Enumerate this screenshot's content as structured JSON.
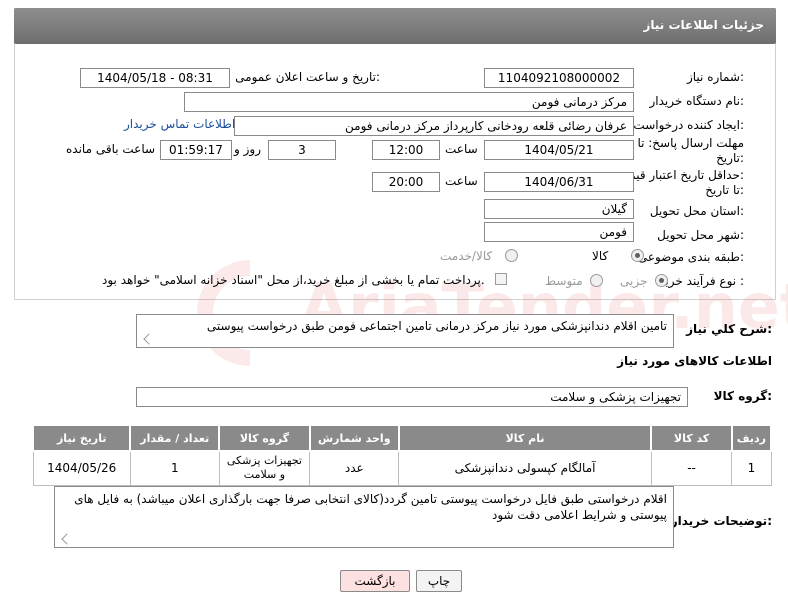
{
  "header": {
    "title": "جزئیات اطلاعات نیاز"
  },
  "form": {
    "need_number_label": "شماره نیاز:",
    "need_number": "1104092108000002",
    "announce_label": "تاریخ و ساعت اعلان عمومی:",
    "announce_value": "1404/05/18 - 08:31",
    "buyer_org_label": "نام دستگاه خریدار:",
    "buyer_org": "مرکز درمانی فومن",
    "requester_label": "ایجاد کننده درخواست:",
    "requester": "عرفان رضائی قلعه رودخانی کارپرداز مرکز درمانی فومن",
    "buyer_contact_link": "اطلاعات تماس خریدار",
    "deadline_label_1": "مهلت ارسال پاسخ: تا",
    "deadline_label_2": "تاریخ:",
    "deadline_date": "1404/05/21",
    "time_label": "ساعت",
    "deadline_time": "12:00",
    "days_value": "3",
    "days_label": "روز و",
    "remaining_time": "01:59:17",
    "remaining_label": "ساعت باقی مانده",
    "price_label_1": "حداقل تاریخ اعتبار قیمت:",
    "price_label_2": "تا تاریخ:",
    "price_date": "1404/06/31",
    "price_time": "20:00",
    "province_label": "استان محل تحویل:",
    "province": "گیلان",
    "city_label": "شهر محل تحویل:",
    "city": "فومن",
    "category_label": "طبقه بندی موضوعی:",
    "category_options": [
      "کالا",
      "کالا/خدمت"
    ],
    "process_label": "نوع فرآیند خرید :",
    "process_options": [
      "جزیی",
      "متوسط"
    ],
    "payment_note": "پرداخت تمام یا بخشی از مبلغ خرید،از محل \"اسناد خزانه اسلامی\" خواهد بود."
  },
  "general": {
    "label": "شرح کلي نیاز:",
    "text": "تامین اقلام دندانپزشکی مورد نیاز مرکز درمانی تامین اجتماعی فومن طبق درخواست پیوستی"
  },
  "goods": {
    "section_title": "اطلاعات کالاهای مورد نیاز",
    "group_label": "گروه کالا:",
    "group_value": "تجهیزات پزشکی و سلامت",
    "columns": [
      "ردیف",
      "کد کالا",
      "نام کالا",
      "واحد شمارش",
      "گروه کالا",
      "تعداد / مقدار",
      "تاریخ نیاز"
    ],
    "rows": [
      [
        "1",
        "--",
        "آمالگام کپسولی دندانپزشکی",
        "عدد",
        "تجهیزات پزشکی و سلامت",
        "1",
        "1404/05/26"
      ]
    ]
  },
  "buyer_notes": {
    "label": "توضیحات خریدار:",
    "text": "اقلام درخواستی طبق فایل درخواست پیوستی تامین گردد(کالای انتخابی صرفا جهت بارگذاری اعلان میباشد) به فایل های پیوستی و شرایط اعلامی دقت شود"
  },
  "buttons": {
    "print": "چاپ",
    "back": "بازگشت"
  },
  "watermark": "AriaTender.net",
  "colors": {
    "header": "#7a7a7a",
    "link": "#1a4f9c",
    "back_button": "#fde0e0",
    "print_button": "#f3f3f3",
    "watermark": "#e45a5a"
  }
}
